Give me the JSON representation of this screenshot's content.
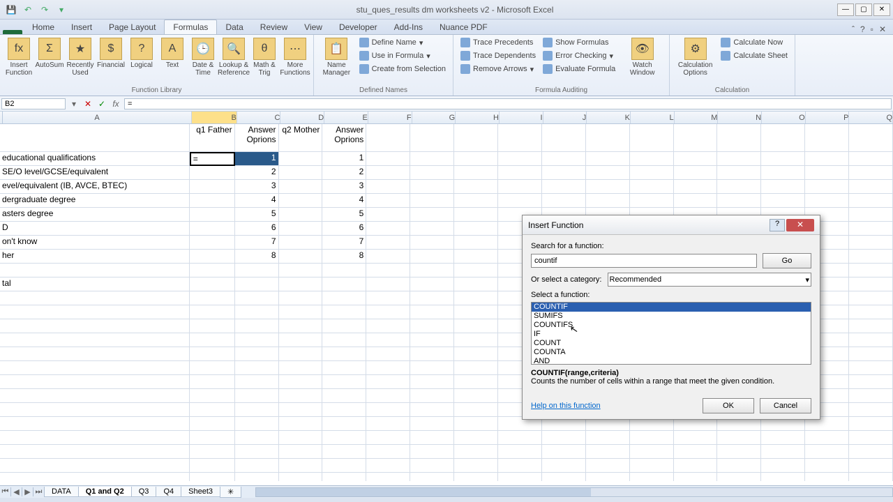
{
  "title": "stu_ques_results dm worksheets v2 - Microsoft Excel",
  "tabs": [
    "Home",
    "Insert",
    "Page Layout",
    "Formulas",
    "Data",
    "Review",
    "View",
    "Developer",
    "Add-Ins",
    "Nuance PDF"
  ],
  "active_tab": "Formulas",
  "ribbon": {
    "func_lib": {
      "label": "Function Library",
      "buttons": [
        "AutoSum",
        "Recently Used",
        "Financial",
        "Logical",
        "Text",
        "Date & Time",
        "Lookup & Reference",
        "Math & Trig",
        "More Functions"
      ]
    },
    "defined_names": {
      "label": "Defined Names",
      "name_mgr": "Name Manager",
      "define": "Define Name",
      "use": "Use in Formula",
      "create": "Create from Selection"
    },
    "auditing": {
      "label": "Formula Auditing",
      "trace_prec": "Trace Precedents",
      "trace_dep": "Trace Dependents",
      "remove": "Remove Arrows",
      "show_f": "Show Formulas",
      "err_chk": "Error Checking",
      "eval": "Evaluate Formula",
      "watch": "Watch Window"
    },
    "calc": {
      "label": "Calculation",
      "options": "Calculation Options",
      "now": "Calculate Now",
      "sheet": "Calculate Sheet"
    }
  },
  "name_box": "B2",
  "formula": "=",
  "columns": [
    "A",
    "B",
    "C",
    "D",
    "E",
    "F",
    "G",
    "H",
    "I",
    "J",
    "K",
    "L",
    "M",
    "N",
    "O",
    "P",
    "Q"
  ],
  "selected_col": "B",
  "header_row": {
    "b": "q1 Father",
    "c": "Answer Oprions",
    "d": "q2 Mother",
    "e": "Answer Oprions"
  },
  "data_rows": [
    {
      "a": "educational qualifications",
      "b": "=",
      "c": "1",
      "e": "1",
      "active": true
    },
    {
      "a": "SE/O level/GCSE/equivalent",
      "c": "2",
      "e": "2"
    },
    {
      "a": "evel/equivalent (IB, AVCE, BTEC)",
      "c": "3",
      "e": "3"
    },
    {
      "a": "dergraduate degree",
      "c": "4",
      "e": "4"
    },
    {
      "a": "asters degree",
      "c": "5",
      "e": "5"
    },
    {
      "a": "D",
      "c": "6",
      "e": "6"
    },
    {
      "a": "on't know",
      "c": "7",
      "e": "7"
    },
    {
      "a": "her",
      "c": "8",
      "e": "8"
    },
    {
      "a": ""
    },
    {
      "a": "tal"
    }
  ],
  "dialog": {
    "title": "Insert Function",
    "search_label": "Search for a function:",
    "search_value": "countif",
    "go": "Go",
    "category_label": "Or select a category:",
    "category_value": "Recommended",
    "select_label": "Select a function:",
    "functions": [
      "COUNTIF",
      "SUMIFS",
      "COUNTIFS",
      "IF",
      "COUNT",
      "COUNTA",
      "AND"
    ],
    "selected_func": "COUNTIF",
    "signature": "COUNTIF(range,criteria)",
    "description": "Counts the number of cells within a range that meet the given condition.",
    "help_link": "Help on this function",
    "ok": "OK",
    "cancel": "Cancel"
  },
  "sheets": [
    "DATA",
    "Q1 and Q2",
    "Q3",
    "Q4",
    "Sheet3"
  ],
  "active_sheet": "Q1 and Q2"
}
